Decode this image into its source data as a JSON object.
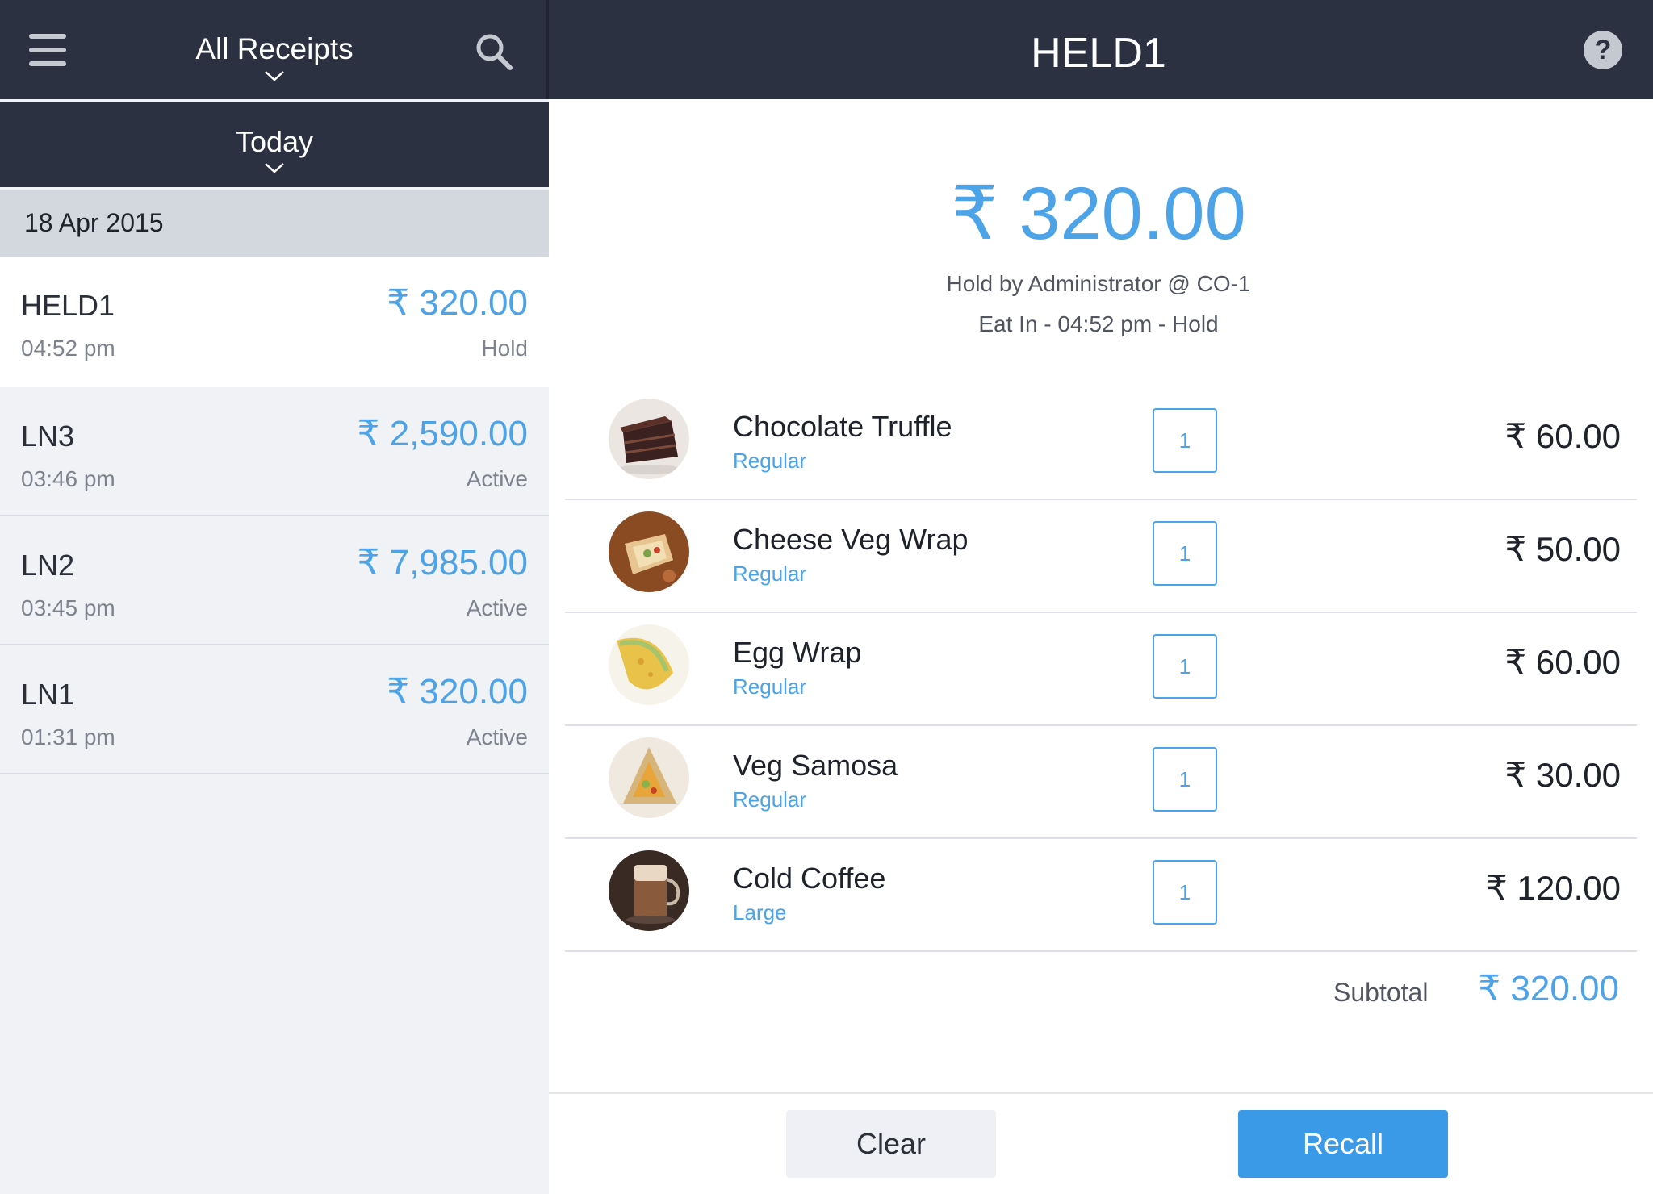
{
  "header": {
    "menu_icon": "hamburger-menu-icon",
    "filter_title": "All Receipts",
    "search_icon": "search-icon",
    "receipt_title": "HELD1",
    "help_icon": "help-question-icon",
    "help_glyph": "?"
  },
  "period": {
    "label": "Today"
  },
  "date_group": "18 Apr 2015",
  "receipts": [
    {
      "id": "HELD1",
      "amount": "₹ 320.00",
      "time": "04:52 pm",
      "status": "Hold"
    },
    {
      "id": "LN3",
      "amount": "₹ 2,590.00",
      "time": "03:46 pm",
      "status": "Active"
    },
    {
      "id": "LN2",
      "amount": "₹ 7,985.00",
      "time": "03:45 pm",
      "status": "Active"
    },
    {
      "id": "LN1",
      "amount": "₹ 320.00",
      "time": "01:31 pm",
      "status": "Active"
    }
  ],
  "detail": {
    "total": "₹ 320.00",
    "hold_info": "Hold by Administrator @ CO-1",
    "order_info": "Eat In - 04:52 pm - Hold",
    "items": [
      {
        "name": "Chocolate Truffle",
        "variant": "Regular",
        "qty": "1",
        "price": "₹ 60.00"
      },
      {
        "name": "Cheese Veg Wrap",
        "variant": "Regular",
        "qty": "1",
        "price": "₹ 50.00"
      },
      {
        "name": "Egg Wrap",
        "variant": "Regular",
        "qty": "1",
        "price": "₹ 60.00"
      },
      {
        "name": "Veg Samosa",
        "variant": "Regular",
        "qty": "1",
        "price": "₹ 30.00"
      },
      {
        "name": "Cold Coffee",
        "variant": "Large",
        "qty": "1",
        "price": "₹ 120.00"
      }
    ],
    "subtotal_label": "Subtotal",
    "subtotal_value": "₹ 320.00"
  },
  "actions": {
    "clear_label": "Clear",
    "recall_label": "Recall"
  },
  "colors": {
    "header_bg": "#2b3140",
    "accent": "#4da3e8",
    "recall_bg": "#3b9ae8",
    "list_bg": "#f0f2f6"
  }
}
